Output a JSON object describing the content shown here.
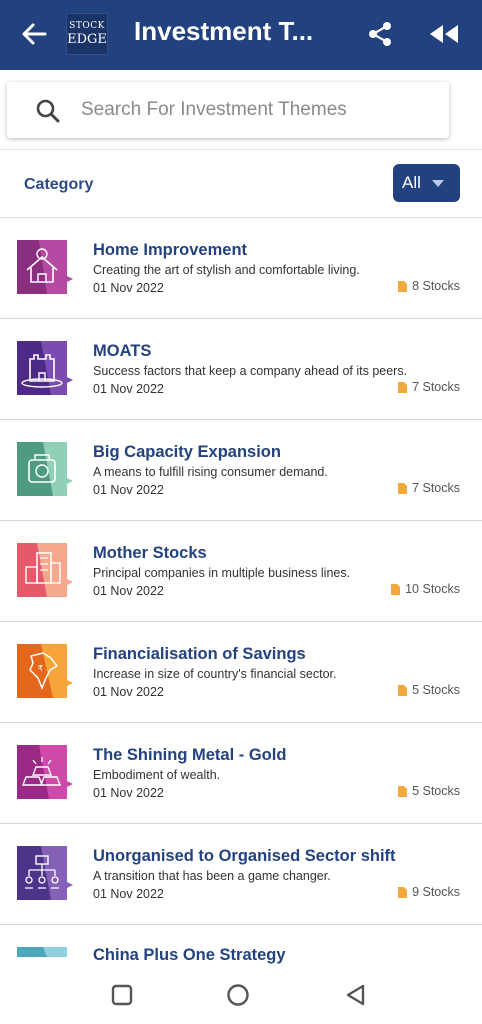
{
  "header": {
    "title": "Investment T...",
    "logo_line1": "STOCK",
    "logo_line2": "EDGE"
  },
  "search": {
    "placeholder": "Search For Investment Themes",
    "value": ""
  },
  "category": {
    "label": "Category",
    "selected": "All"
  },
  "themes": [
    {
      "title": "Home Improvement",
      "description": "Creating the art of stylish and comfortable living.",
      "date": "01 Nov 2022",
      "stocks": "8 Stocks",
      "icon": "home-improvement-icon",
      "colors": [
        "#8a2f7f",
        "#b64aa2"
      ]
    },
    {
      "title": "MOATS",
      "description": "Success factors that keep a company ahead of its peers.",
      "date": "01 Nov 2022",
      "stocks": "7 Stocks",
      "icon": "castle-icon",
      "colors": [
        "#4d2a86",
        "#7b4cb0"
      ]
    },
    {
      "title": "Big Capacity Expansion",
      "description": "A means to fulfill rising consumer demand.",
      "date": "01 Nov 2022",
      "stocks": "7 Stocks",
      "icon": "factory-expansion-icon",
      "colors": [
        "#4f9a82",
        "#8fd0b6"
      ]
    },
    {
      "title": "Mother Stocks",
      "description": "Principal companies in multiple business lines.",
      "date": "01 Nov 2022",
      "stocks": "10 Stocks",
      "icon": "buildings-icon",
      "colors": [
        "#e45a6b",
        "#f6a88e"
      ]
    },
    {
      "title": "Financialisation of Savings",
      "description": "Increase in size of country's financial sector.",
      "date": "01 Nov 2022",
      "stocks": "5 Stocks",
      "icon": "india-map-icon",
      "colors": [
        "#e3671d",
        "#f5a53a"
      ]
    },
    {
      "title": "The Shining Metal - Gold",
      "description": "Embodiment of wealth.",
      "date": "01 Nov 2022",
      "stocks": "5 Stocks",
      "icon": "gold-bars-icon",
      "colors": [
        "#9a2a86",
        "#cf4aa8"
      ]
    },
    {
      "title": "Unorganised to Organised Sector shift",
      "description": "A transition that has been a game changer.",
      "date": "01 Nov 2022",
      "stocks": "9 Stocks",
      "icon": "org-chart-icon",
      "colors": [
        "#4b3489",
        "#8460b6"
      ]
    }
  ],
  "partial_theme": {
    "title": "China Plus One Strategy",
    "colors": [
      "#4aa8b8",
      "#8ed0dc"
    ]
  },
  "accent_colors": {
    "header": "#22417f",
    "title_text": "#23427f",
    "stocks_icon": "#f1a93c"
  }
}
